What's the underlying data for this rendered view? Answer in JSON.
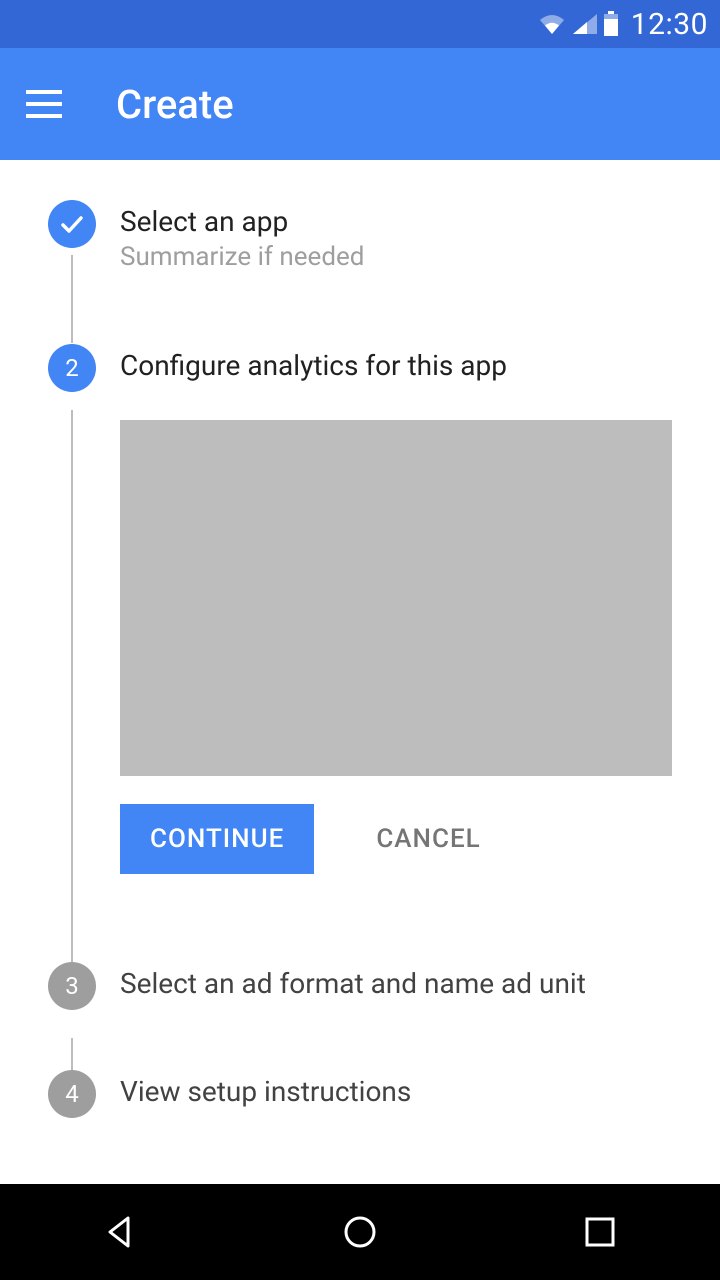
{
  "status": {
    "time": "12:30"
  },
  "appbar": {
    "title": "Create"
  },
  "steps": [
    {
      "title": "Select an app",
      "subtitle": "Summarize if needed"
    },
    {
      "number": "2",
      "title": "Configure analytics for this app"
    },
    {
      "number": "3",
      "title": "Select an ad format and name ad unit"
    },
    {
      "number": "4",
      "title": "View setup instructions"
    }
  ],
  "buttons": {
    "continue": "CONTINUE",
    "cancel": "CANCEL"
  }
}
